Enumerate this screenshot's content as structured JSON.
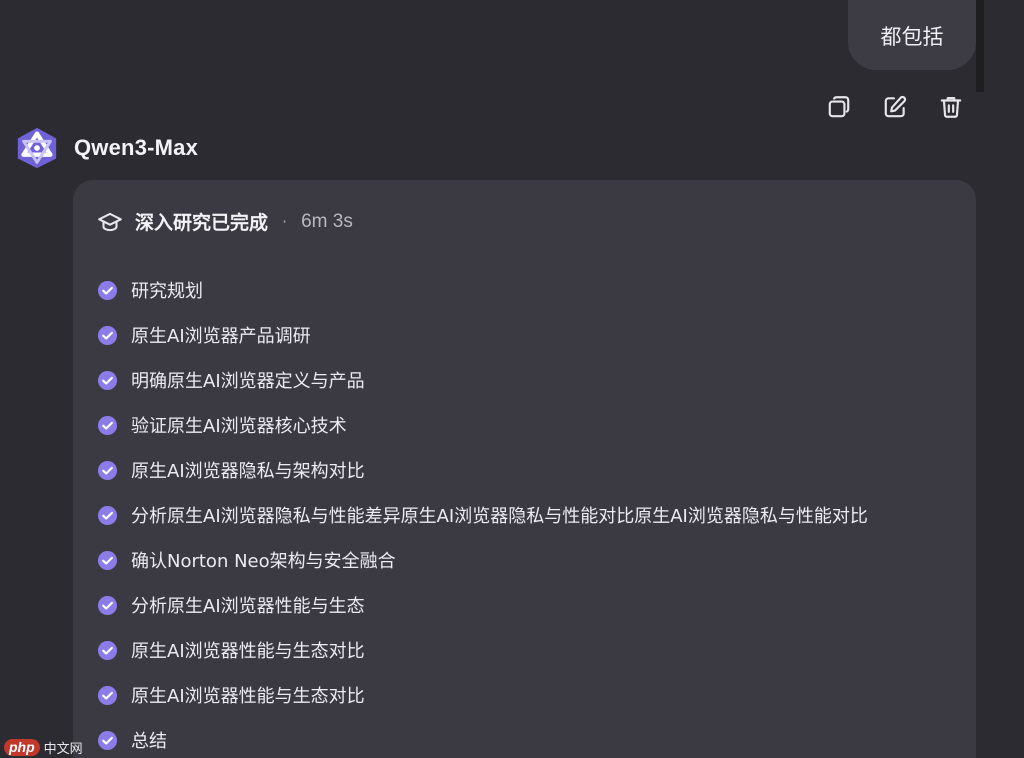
{
  "user_message": {
    "text": "都包括"
  },
  "message_actions": {
    "copy_icon": "copy-icon",
    "edit_icon": "edit-icon",
    "delete_icon": "trash-icon"
  },
  "assistant": {
    "logo_icon": "qwen-logo-icon",
    "model_name": "Qwen3-Max"
  },
  "research": {
    "icon": "graduation-cap-icon",
    "title": "深入研究已完成",
    "separator": "·",
    "duration": "6m 3s",
    "steps": [
      {
        "label": "研究规划",
        "status": "done"
      },
      {
        "label": "原生AI浏览器产品调研",
        "status": "done"
      },
      {
        "label": "明确原生AI浏览器定义与产品",
        "status": "done"
      },
      {
        "label": "验证原生AI浏览器核心技术",
        "status": "done"
      },
      {
        "label": "原生AI浏览器隐私与架构对比",
        "status": "done"
      },
      {
        "label": "分析原生AI浏览器隐私与性能差异原生AI浏览器隐私与性能对比原生AI浏览器隐私与性能对比",
        "status": "done"
      },
      {
        "label": "确认Norton Neo架构与安全融合",
        "status": "done"
      },
      {
        "label": "分析原生AI浏览器性能与生态",
        "status": "done"
      },
      {
        "label": "原生AI浏览器性能与生态对比",
        "status": "done"
      },
      {
        "label": "原生AI浏览器性能与生态对比",
        "status": "done"
      },
      {
        "label": "总结",
        "status": "done"
      }
    ]
  },
  "watermark": {
    "logo": "php",
    "text": "中文网"
  },
  "colors": {
    "background": "#2c2b31",
    "card": "#3b3a42",
    "accent_purple": "#8b7ce8",
    "bubble": "#3d3c44"
  }
}
